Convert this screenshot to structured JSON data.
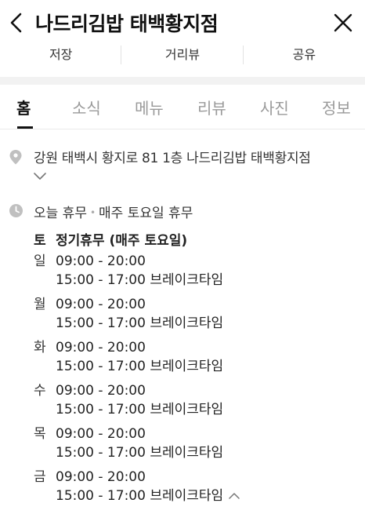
{
  "header": {
    "title": "나드리김밥 태백황지점",
    "back_icon": "chevron-left-icon",
    "close_icon": "close-icon"
  },
  "actions": [
    {
      "label": "저장"
    },
    {
      "label": "거리뷰"
    },
    {
      "label": "공유"
    }
  ],
  "tabs": [
    {
      "label": "홈",
      "active": true
    },
    {
      "label": "소식"
    },
    {
      "label": "메뉴"
    },
    {
      "label": "리뷰"
    },
    {
      "label": "사진"
    },
    {
      "label": "정보"
    }
  ],
  "address": {
    "text": "강원 태백시 황지로 81 1층 나드리김밥 태백황지점",
    "icon": "location-pin-icon",
    "expand_icon": "chevron-down-icon"
  },
  "hours": {
    "icon": "clock-icon",
    "today_label": "오늘 휴무",
    "today_detail": "매주 토요일 휴무",
    "separator": "•",
    "holiday": {
      "day": "토",
      "text": "정기휴무 (매주 토요일)"
    },
    "days": [
      {
        "day": "일",
        "open": "09:00 - 20:00",
        "brk": "15:00 - 17:00 브레이크타임"
      },
      {
        "day": "월",
        "open": "09:00 - 20:00",
        "brk": "15:00 - 17:00 브레이크타임"
      },
      {
        "day": "화",
        "open": "09:00 - 20:00",
        "brk": "15:00 - 17:00 브레이크타임"
      },
      {
        "day": "수",
        "open": "09:00 - 20:00",
        "brk": "15:00 - 17:00 브레이크타임"
      },
      {
        "day": "목",
        "open": "09:00 - 20:00",
        "brk": "15:00 - 17:00 브레이크타임"
      },
      {
        "day": "금",
        "open": "09:00 - 20:00",
        "brk": "15:00 - 17:00 브레이크타임"
      }
    ],
    "collapse_icon": "chevron-up-icon"
  },
  "colors": {
    "text": "#222222",
    "muted": "#9a9a9a",
    "icon_gray": "#bdbdbd",
    "divider": "#f2f2f2"
  }
}
